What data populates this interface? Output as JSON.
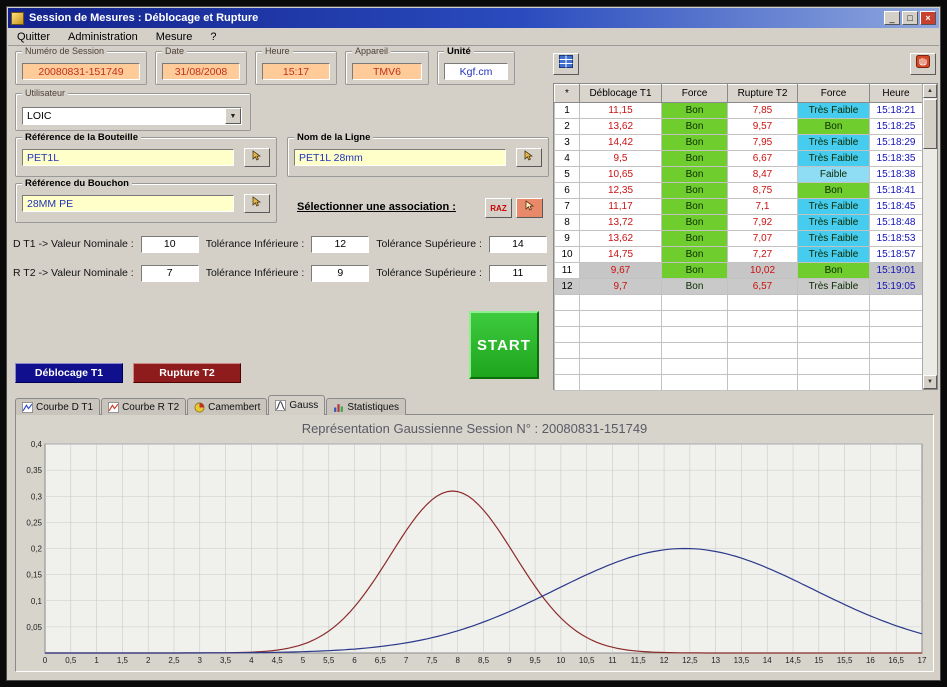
{
  "window": {
    "title": "Session de Mesures : Déblocage et Rupture",
    "controls": {
      "minimize": "_",
      "maximize": "□",
      "close": "×"
    }
  },
  "menu": {
    "items": [
      "Quitter",
      "Administration",
      "Mesure",
      "?"
    ]
  },
  "session": {
    "numero": {
      "label": "Numéro de Session",
      "value": "20080831-151749"
    },
    "date": {
      "label": "Date",
      "value": "31/08/2008"
    },
    "heure": {
      "label": "Heure",
      "value": "15:17"
    },
    "appareil": {
      "label": "Appareil",
      "value": "TMV6"
    },
    "unite": {
      "label": "Unité",
      "value": "Kgf.cm"
    }
  },
  "utilisateur": {
    "label": "Utilisateur",
    "value": "LOIC"
  },
  "bouteille": {
    "label": "Référence de la Bouteille",
    "value": "PET1L"
  },
  "ligne": {
    "label": "Nom de la Ligne",
    "value": "PET1L 28mm"
  },
  "bouchon": {
    "label": "Référence du Bouchon",
    "value": "28MM PE"
  },
  "association": {
    "label": "Sélectionner une association :",
    "raz_label": "RAZ"
  },
  "tolerances": {
    "d_t1": {
      "prefix": "D T1 -> Valeur Nominale :",
      "nominale": "10",
      "inf_label": "Tolérance Inférieure :",
      "inf": "12",
      "sup_label": "Tolérance Supérieure :",
      "sup": "14"
    },
    "r_t2": {
      "prefix": "R T2 -> Valeur Nominale :",
      "nominale": "7",
      "inf_label": "Tolérance Inférieure :",
      "inf": "9",
      "sup_label": "Tolérance Supérieure :",
      "sup": "11"
    }
  },
  "buttons": {
    "deblocage": "Déblocage T1",
    "rupture": "Rupture T2",
    "start": "START"
  },
  "icons": {
    "toolbar_left": "table-export-icon",
    "toolbar_right": "hand-stop-icon",
    "reference_buttons": "pointer-hand-icon",
    "scroll": [
      "scroll-up-icon",
      "scroll-down-icon"
    ]
  },
  "table": {
    "columns": [
      "*",
      "Déblocage T1",
      "Force",
      "Rupture T2",
      "Force",
      "Heure"
    ],
    "force_colors": {
      "Bon": "#6FCE2E",
      "Faible": "#8FDCF5",
      "Très Faible": "#45CCEE"
    },
    "selected_bg": "#C9C9C9",
    "dimmed_bg": "#C6C6C6",
    "rows": [
      {
        "n": "1",
        "d_t1": "11,15",
        "force1": "Bon",
        "r_t2": "7,85",
        "force2": "Très Faible",
        "heure": "15:18:21",
        "state": "normal"
      },
      {
        "n": "2",
        "d_t1": "13,62",
        "force1": "Bon",
        "r_t2": "9,57",
        "force2": "Bon",
        "heure": "15:18:25",
        "state": "normal"
      },
      {
        "n": "3",
        "d_t1": "14,42",
        "force1": "Bon",
        "r_t2": "7,95",
        "force2": "Très Faible",
        "heure": "15:18:29",
        "state": "normal"
      },
      {
        "n": "4",
        "d_t1": "9,5",
        "force1": "Bon",
        "r_t2": "6,67",
        "force2": "Très Faible",
        "heure": "15:18:35",
        "state": "normal"
      },
      {
        "n": "5",
        "d_t1": "10,65",
        "force1": "Bon",
        "r_t2": "8,47",
        "force2": "Faible",
        "heure": "15:18:38",
        "state": "normal"
      },
      {
        "n": "6",
        "d_t1": "12,35",
        "force1": "Bon",
        "r_t2": "8,75",
        "force2": "Bon",
        "heure": "15:18:41",
        "state": "normal"
      },
      {
        "n": "7",
        "d_t1": "11,17",
        "force1": "Bon",
        "r_t2": "7,1",
        "force2": "Très Faible",
        "heure": "15:18:45",
        "state": "normal"
      },
      {
        "n": "8",
        "d_t1": "13,72",
        "force1": "Bon",
        "r_t2": "7,92",
        "force2": "Très Faible",
        "heure": "15:18:48",
        "state": "normal"
      },
      {
        "n": "9",
        "d_t1": "13,62",
        "force1": "Bon",
        "r_t2": "7,07",
        "force2": "Très Faible",
        "heure": "15:18:53",
        "state": "normal"
      },
      {
        "n": "10",
        "d_t1": "14,75",
        "force1": "Bon",
        "r_t2": "7,27",
        "force2": "Très Faible",
        "heure": "15:18:57",
        "state": "normal"
      },
      {
        "n": "11",
        "d_t1": "9,67",
        "force1": "Bon",
        "r_t2": "10,02",
        "force2": "Bon",
        "heure": "15:19:01",
        "state": "dimmed"
      },
      {
        "n": "12",
        "d_t1": "9,7",
        "force1": "Bon",
        "r_t2": "6,57",
        "force2": "Très Faible",
        "heure": "15:19:05",
        "state": "selected"
      }
    ],
    "empty_row_count": 6
  },
  "tabs": {
    "items": [
      {
        "label": "Courbe D T1",
        "icon": "line-chart-blue-icon",
        "active": false
      },
      {
        "label": "Courbe R T2",
        "icon": "line-chart-red-icon",
        "active": false
      },
      {
        "label": "Camembert",
        "icon": "pie-chart-icon",
        "active": false
      },
      {
        "label": "Gauss",
        "icon": "gauss-curve-icon",
        "active": true
      },
      {
        "label": "Statistiques",
        "icon": "bar-chart-icon",
        "active": false
      }
    ]
  },
  "chart_data": {
    "type": "line",
    "title": "Représentation Gaussienne   Session N° : 20080831-151749",
    "x_axis": {
      "min": 0,
      "max": 17,
      "tick_step": 0.5
    },
    "y_axis": {
      "min": 0,
      "max": 0.4,
      "tick_step": 0.05
    },
    "grid": true,
    "legend": "none",
    "series": [
      {
        "name": "Rupture T2",
        "shape": "gaussian",
        "mean": 7.9,
        "sigma": 1.2,
        "peak": 0.31,
        "color": "#8C2B2B"
      },
      {
        "name": "Déblocage T1",
        "shape": "gaussian",
        "mean": 12.4,
        "sigma": 2.5,
        "peak": 0.2,
        "color": "#2B3A8C"
      }
    ]
  }
}
